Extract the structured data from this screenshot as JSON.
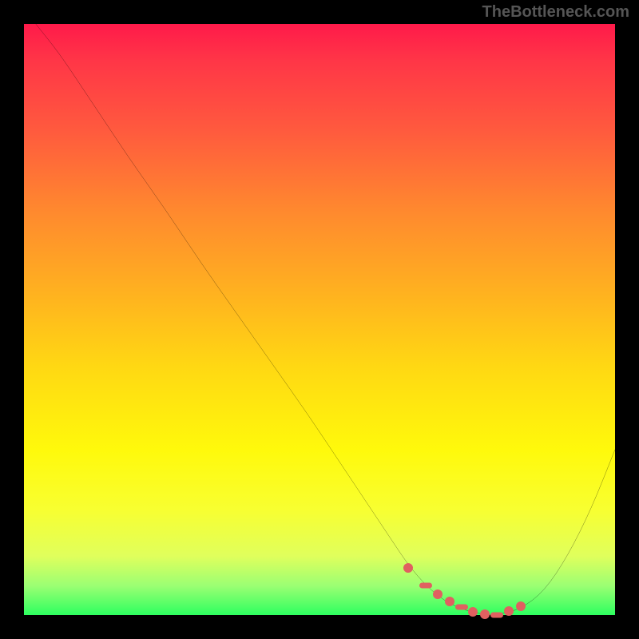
{
  "watermark": "TheBottleneck.com",
  "chart_data": {
    "type": "line",
    "title": "",
    "xlabel": "",
    "ylabel": "",
    "xlim": [
      0,
      100
    ],
    "ylim": [
      0,
      100
    ],
    "grid": false,
    "background_gradient": [
      "#ff1a4a",
      "#ff5a3e",
      "#ffb31f",
      "#fff90b",
      "#9cff73",
      "#2dff60"
    ],
    "series": [
      {
        "name": "curve",
        "color": "#000000",
        "x": [
          2,
          6,
          10,
          14,
          18,
          24,
          30,
          36,
          42,
          48,
          54,
          58,
          62,
          65,
          68,
          71,
          74,
          77,
          80,
          84,
          88,
          92,
          96,
          100
        ],
        "y": [
          100,
          95,
          89,
          83,
          77,
          68.5,
          59.5,
          51,
          42.5,
          34,
          25,
          19,
          13,
          8.5,
          5,
          2.5,
          1,
          0.2,
          0,
          1,
          4,
          10,
          18,
          28
        ]
      }
    ],
    "markers": {
      "name": "highlight-cluster",
      "color": "#e06060",
      "x": [
        65,
        68,
        70,
        72,
        74,
        76,
        78,
        80,
        82,
        84
      ],
      "y": [
        8,
        5,
        3.5,
        2.3,
        1.3,
        0.6,
        0.2,
        0.0,
        0.7,
        1.5
      ]
    }
  }
}
